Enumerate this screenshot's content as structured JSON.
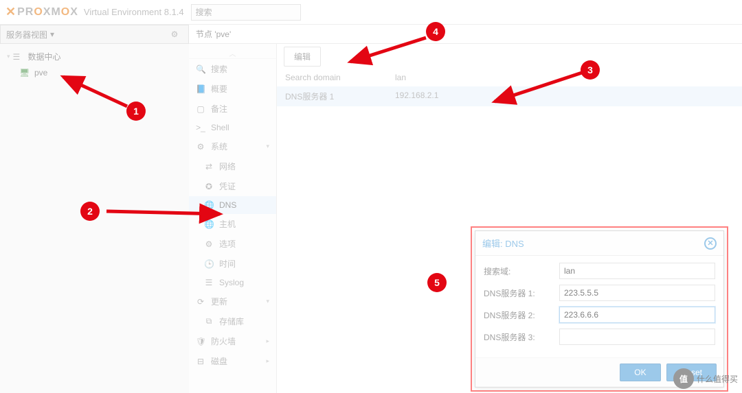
{
  "header": {
    "product": "PROXMOX",
    "ve_label": "Virtual Environment 8.1.4",
    "search_placeholder": "搜索"
  },
  "sidebar": {
    "view_label": "服务器视图",
    "tree": {
      "datacenter": "数据中心",
      "node": "pve"
    }
  },
  "content": {
    "title": "节点 'pve'",
    "nav": {
      "search": "搜索",
      "summary": "概要",
      "notes": "备注",
      "shell": "Shell",
      "system": "系统",
      "network": "网络",
      "certificates": "凭证",
      "dns": "DNS",
      "hosts": "主机",
      "options": "选项",
      "time": "时间",
      "syslog": "Syslog",
      "updates": "更新",
      "repositories": "存储库",
      "firewall": "防火墙",
      "disks": "磁盘"
    },
    "toolbar": {
      "edit": "编辑"
    },
    "table": {
      "search_domain_label": "Search domain",
      "search_domain_value": "lan",
      "dns1_label": "DNS服务器 1",
      "dns1_value": "192.168.2.1"
    }
  },
  "dialog": {
    "title": "编辑: DNS",
    "fields": {
      "search_domain": {
        "label": "搜索域:",
        "value": "lan"
      },
      "dns1": {
        "label": "DNS服务器 1:",
        "value": "223.5.5.5"
      },
      "dns2": {
        "label": "DNS服务器 2:",
        "value": "223.6.6.6"
      },
      "dns3": {
        "label": "DNS服务器 3:",
        "value": ""
      }
    },
    "buttons": {
      "ok": "OK",
      "reset": "Reset"
    }
  },
  "annotations": {
    "m1": "1",
    "m2": "2",
    "m3": "3",
    "m4": "4",
    "m5": "5"
  },
  "watermark": {
    "icon": "值",
    "text": "什么值得买"
  }
}
